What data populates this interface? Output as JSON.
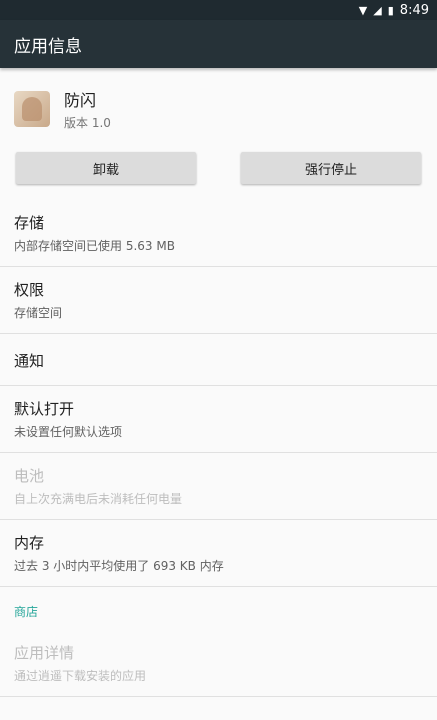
{
  "status_bar": {
    "time": "8:49",
    "wifi_icon": "wifi-icon",
    "signal_icon": "signal-icon",
    "battery_icon": "battery-icon"
  },
  "app_bar": {
    "title": "应用信息"
  },
  "app": {
    "name": "防闪",
    "version": "版本 1.0",
    "icon": "app-icon"
  },
  "buttons": {
    "uninstall": "卸载",
    "force_stop": "强行停止"
  },
  "items": {
    "storage": {
      "title": "存储",
      "sub": "内部存储空间已使用 5.63 MB"
    },
    "permissions": {
      "title": "权限",
      "sub": "存储空间"
    },
    "notifications": {
      "title": "通知"
    },
    "open_by_default": {
      "title": "默认打开",
      "sub": "未设置任何默认选项"
    },
    "battery": {
      "title": "电池",
      "sub": "自上次充满电后未消耗任何电量"
    },
    "memory": {
      "title": "内存",
      "sub": "过去 3 小时内平均使用了 693 KB 内存"
    }
  },
  "store_section": {
    "label": "商店"
  },
  "app_details": {
    "title": "应用详情",
    "sub": "通过逍遥下载安装的应用"
  },
  "colors": {
    "app_bar": "#263238",
    "accent": "#26a69a",
    "background": "#fafafa"
  }
}
